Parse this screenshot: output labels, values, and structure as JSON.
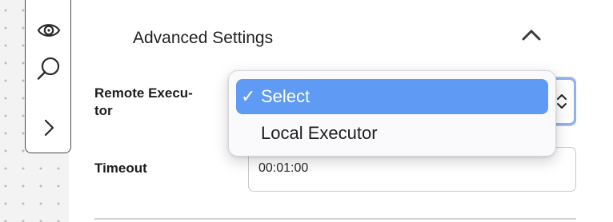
{
  "section": {
    "title": "Advanced Settings"
  },
  "remote_executor": {
    "label": "Remote Execu-\ntor",
    "options": [
      {
        "label": "Select",
        "selected": true
      },
      {
        "label": "Local Executor",
        "selected": false
      }
    ],
    "checkmark": "✓"
  },
  "timeout": {
    "label": "Timeout",
    "value": "00:01:00"
  },
  "toolbar": {
    "icons": [
      "eye-icon",
      "search-icon",
      "chevron-right-icon"
    ]
  },
  "colors": {
    "highlight": "#5f9bf4",
    "focus_ring": "#8fb2ee"
  }
}
